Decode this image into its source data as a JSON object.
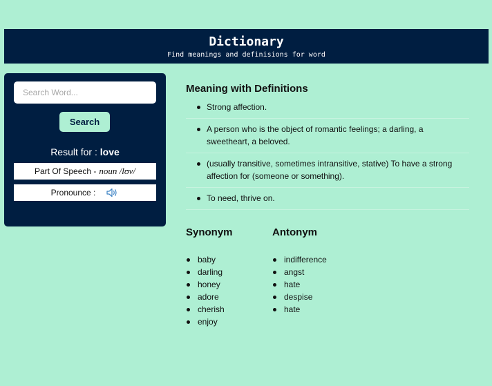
{
  "header": {
    "title": "Dictionary",
    "subtitle": "Find meanings and definisions for word"
  },
  "sidebar": {
    "search_placeholder": "Search Word...",
    "search_button": "Search",
    "result_for_label": "Result for :",
    "result_word": "love",
    "part_of_speech_label": "Part Of Speech -",
    "part_of_speech_value": "noun /lʊv/",
    "pronounce_label": "Pronounce :",
    "speaker_icon": "speaker-icon"
  },
  "main": {
    "meaning_title": "Meaning with Definitions",
    "definitions": [
      "Strong affection.",
      "A person who is the object of romantic feelings; a darling, a sweetheart, a beloved.",
      "(usually transitive, sometimes intransitive, stative) To have a strong affection for (someone or something).",
      "To need, thrive on."
    ],
    "synonym_title": "Synonym",
    "synonyms": [
      "baby",
      "darling",
      "honey",
      "adore",
      "cherish",
      "enjoy"
    ],
    "antonym_title": "Antonym",
    "antonyms": [
      "indifference",
      "angst",
      "hate",
      "despise",
      "hate"
    ]
  },
  "colors": {
    "background": "#aeefd3",
    "navy": "#001e41",
    "accent": "#aeefd3",
    "speaker_blue": "#3b82c4"
  }
}
